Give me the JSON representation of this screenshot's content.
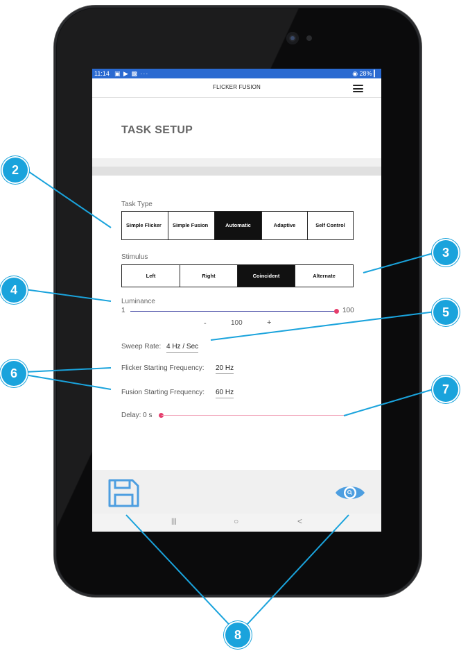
{
  "status_bar": {
    "time": "11:14",
    "icons": "▣ ▶ ▩ ···",
    "battery": "◉ 28% ▎"
  },
  "app_bar": {
    "title": "FLICKER FUSION",
    "menu_icon": "hamburger-icon"
  },
  "page": {
    "heading": "TASK SETUP"
  },
  "task_type": {
    "label": "Task Type",
    "options": [
      "Simple Flicker",
      "Simple Fusion",
      "Automatic",
      "Adaptive",
      "Self Control"
    ],
    "selected": "Automatic"
  },
  "stimulus": {
    "label": "Stimulus",
    "options": [
      "Left",
      "Right",
      "Coincident",
      "Alternate"
    ],
    "selected": "Coincident"
  },
  "luminance": {
    "label": "Luminance",
    "min_label": "1",
    "max_label": "100",
    "value": 100,
    "minus": "-",
    "display_value": "100",
    "plus": "+"
  },
  "sweep_rate": {
    "label": "Sweep Rate:",
    "value": "4 Hz / Sec"
  },
  "flicker_start": {
    "label": "Flicker Starting Frequency:",
    "value": "20 Hz"
  },
  "fusion_start": {
    "label": "Fusion Starting Frequency:",
    "value": "60 Hz"
  },
  "delay": {
    "label": "Delay: 0 s",
    "value": 0
  },
  "bottom_actions": {
    "save_icon": "floppy-disk-icon",
    "preview_icon": "eye-icon"
  },
  "nav_bar": {
    "recents": "|||",
    "home": "○",
    "back": "<"
  },
  "callouts": [
    "2",
    "3",
    "4",
    "5",
    "6",
    "7",
    "8"
  ],
  "colors": {
    "accent": "#e53d6c",
    "callout": "#1aa3dc",
    "status_bar": "#2a6ad1",
    "icon_blue": "#4d9ee0",
    "luminance_track": "#3a3fa0"
  }
}
